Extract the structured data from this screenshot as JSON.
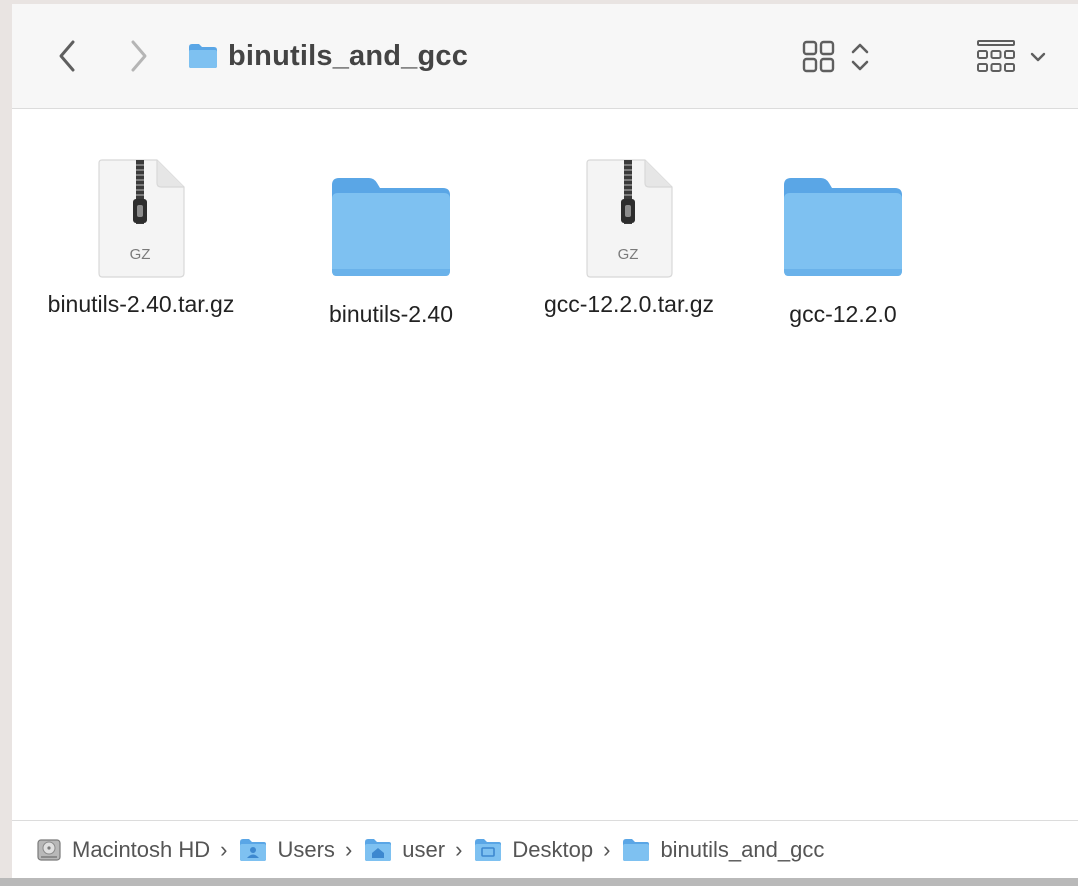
{
  "window": {
    "title": "binutils_and_gcc"
  },
  "toolbar": {
    "back_icon": "chevron-left-icon",
    "forward_icon": "chevron-right-icon",
    "view_icon": "icon-grid-view-icon",
    "group_icon": "group-by-icon"
  },
  "items": [
    {
      "name": "binutils-2.40.tar.gz",
      "kind": "archive",
      "badge": "GZ"
    },
    {
      "name": "binutils-2.40",
      "kind": "folder"
    },
    {
      "name": "gcc-12.2.0.tar.gz",
      "kind": "archive",
      "badge": "GZ"
    },
    {
      "name": "gcc-12.2.0",
      "kind": "folder"
    }
  ],
  "pathbar": {
    "crumbs": [
      {
        "label": "Macintosh HD",
        "icon": "hard-drive-icon"
      },
      {
        "label": "Users",
        "icon": "users-folder-icon"
      },
      {
        "label": "user",
        "icon": "home-folder-icon"
      },
      {
        "label": "Desktop",
        "icon": "desktop-folder-icon"
      },
      {
        "label": "binutils_and_gcc",
        "icon": "folder-icon"
      }
    ],
    "separator": "›"
  },
  "colors": {
    "folder_blue": "#7ec1f1",
    "folder_tab": "#5aa6e6",
    "toolbar_bg": "#f7f7f7",
    "icon_gray": "#5f5f5f"
  }
}
